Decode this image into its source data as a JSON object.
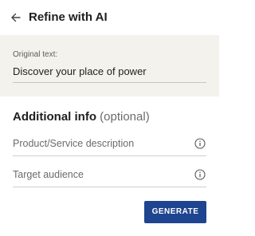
{
  "header": {
    "back_icon": "arrow-left-icon",
    "title": "Refine with AI"
  },
  "original": {
    "label": "Original text:",
    "value": "Discover your place of power"
  },
  "additional": {
    "title": "Additional info",
    "optional_label": "(optional)",
    "fields": [
      {
        "placeholder": "Product/Service description",
        "value": "",
        "icon": "info-circle-icon"
      },
      {
        "placeholder": "Target audience",
        "value": "",
        "icon": "info-circle-icon"
      }
    ]
  },
  "actions": {
    "generate_label": "GENERATE"
  },
  "colors": {
    "accent": "#1f4590",
    "original_panel_bg": "#f4f2ec",
    "text": "#1f1f1f",
    "muted_text": "#6c6c6c"
  }
}
